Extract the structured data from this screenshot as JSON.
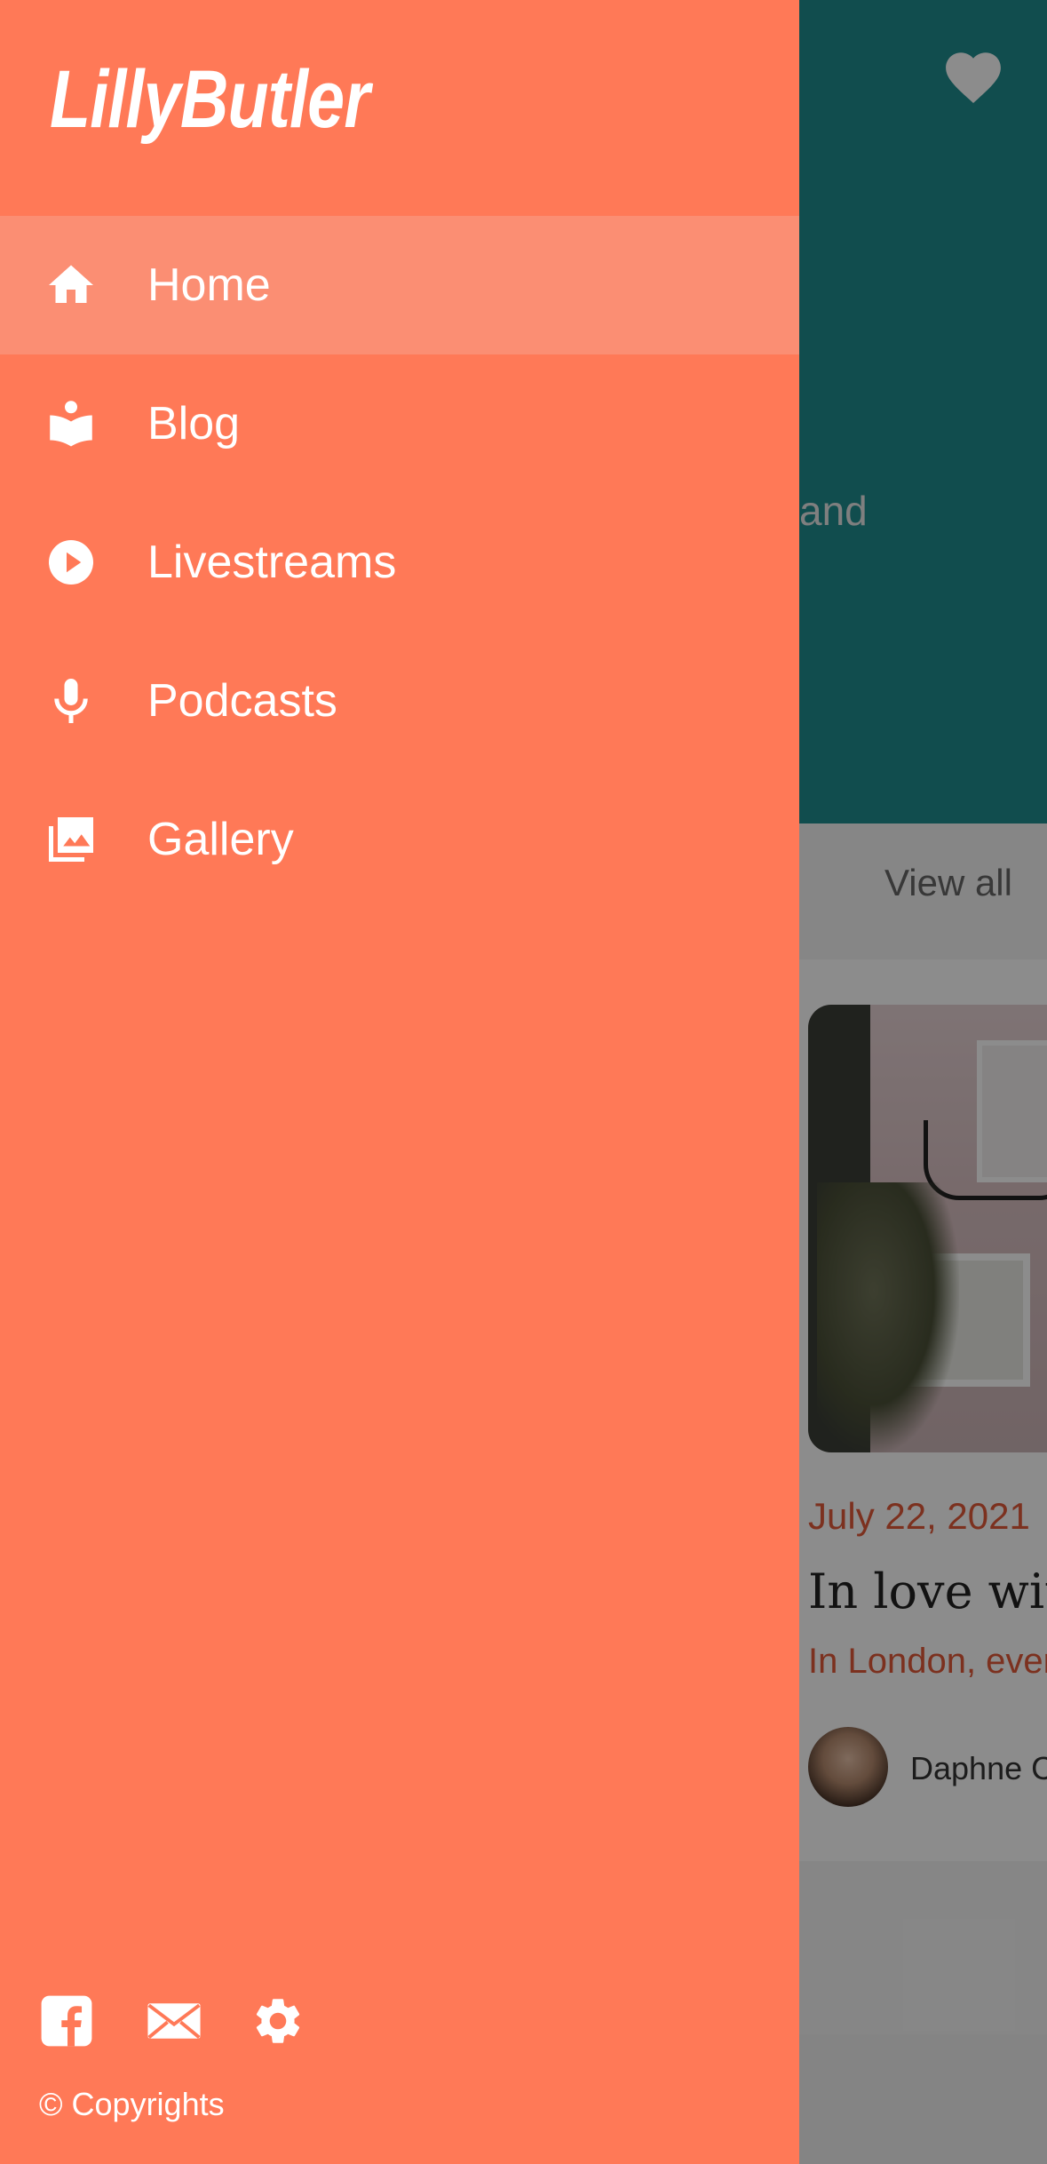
{
  "app": {
    "brand": "LillyButler"
  },
  "drawer": {
    "items": [
      {
        "label": "Home",
        "icon": "home-icon",
        "active": true
      },
      {
        "label": "Blog",
        "icon": "book-reader-icon",
        "active": false
      },
      {
        "label": "Livestreams",
        "icon": "play-circle-icon",
        "active": false
      },
      {
        "label": "Podcasts",
        "icon": "microphone-icon",
        "active": false
      },
      {
        "label": "Gallery",
        "icon": "photo-library-icon",
        "active": false
      }
    ],
    "footer": {
      "icons": [
        "facebook-icon",
        "mail-icon",
        "settings-icon"
      ],
      "copyright": "© Copyrights"
    }
  },
  "background_page": {
    "hero_text_fragment": "and",
    "view_all": "View all",
    "card": {
      "date": "July 22, 2021",
      "title": "In love wit",
      "excerpt": "In London, ever",
      "author": "Daphne C"
    }
  },
  "colors": {
    "drawer_bg": "#ff7957",
    "drawer_active": "#fb8e73",
    "hero_bg": "#1f8c8e",
    "accent": "#e2593a"
  }
}
